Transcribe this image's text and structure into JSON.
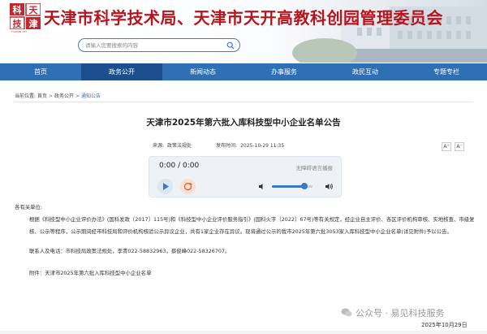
{
  "header": {
    "logo_text": "TIANJIN STI",
    "site_title": "天津市科学技术局、天津市天开高教科创园管理委员会",
    "search_placeholder": "请输入您要搜索的内容"
  },
  "nav": {
    "items": [
      "首页",
      "政务公开",
      "新闻动态",
      "办事服务",
      "政民互动",
      "专题专栏"
    ],
    "active_index": 1
  },
  "breadcrumb": {
    "label": "当前位置:",
    "items": [
      "首页",
      "政务公开",
      "通知公告"
    ],
    "separator": ">"
  },
  "article": {
    "title": "天津市2025年第六批入库科技型中小企业名单公告",
    "source_label": "来源:",
    "source": "政策法规处",
    "time_label": "发布时间:",
    "time": "2025-10-29 11:35",
    "font_up": "A⁺",
    "font_down": "A⁻"
  },
  "player": {
    "current": "0:00",
    "sep": "/",
    "total": "0:00",
    "note": "无障碍语言播报",
    "volume": 0.8
  },
  "body": {
    "greeting": "各有关单位:",
    "para1": "根据《科技型中小企业评价办法》(国科发政〔2017〕115号)和《科技型中小企业评价服务指引》(国科火字〔2022〕67号)等有关规定，经企业自主评价、各区评价机构审核、实地核查、市级复核、公示等程序，公示期间经市科技局和评价机构核验公示异议企业，共有1家企业存在异议。现将通过公示的我市2025年第六批3053家入库科技型中小企业名单(详见附件)予以公告。",
    "contact": "联系人及电话：市科技局政策法规处，李青022-58832963，蔡俊峰022-58326707。",
    "attachment": "附件：天津市2025年第六批入库科技型中小企业名单"
  },
  "footer": {
    "watermark": "公众号 · 易见科技服务",
    "date": "2025年10月29日"
  },
  "colors": {
    "brand_red": "#b8141d",
    "nav_blue": "#2f6fb3",
    "nav_active": "#1d4f8f"
  }
}
